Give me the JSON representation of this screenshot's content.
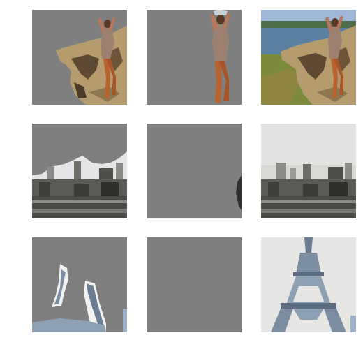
{
  "grid": {
    "rows": [
      {
        "scene": "woman-on-driftwood",
        "tiles": [
          {
            "kind": "segment-driftwood",
            "label": ""
          },
          {
            "kind": "segment-person",
            "label": ""
          },
          {
            "kind": "original-photo",
            "label": ""
          }
        ]
      },
      {
        "scene": "city-skyline",
        "tiles": [
          {
            "kind": "segment-city",
            "label": ""
          },
          {
            "kind": "segment-edge-object",
            "label": ""
          },
          {
            "kind": "original-photo",
            "label": ""
          }
        ]
      },
      {
        "scene": "eiffel-tower",
        "tiles": [
          {
            "kind": "segment-tower",
            "label": ""
          },
          {
            "kind": "segment-empty",
            "label": ""
          },
          {
            "kind": "original-photo",
            "label": ""
          }
        ]
      }
    ]
  },
  "colors": {
    "mask_gray": "#7f7f7f",
    "background": "#ffffff"
  }
}
